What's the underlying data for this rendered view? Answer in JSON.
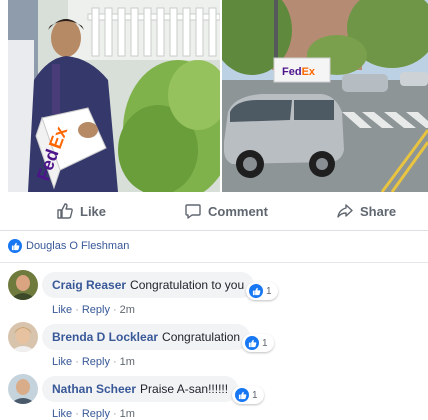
{
  "post": {
    "photos": [
      {
        "name": "delivery-photo",
        "fedex_text": "FedEx"
      },
      {
        "name": "street-photo",
        "fedex_text": "FedEx"
      }
    ],
    "actions": {
      "like_label": "Like",
      "comment_label": "Comment",
      "share_label": "Share"
    },
    "reactions": {
      "icon": "like-icon",
      "name": "Douglas O Fleshman"
    }
  },
  "comments": [
    {
      "author": "Craig Reaser",
      "text": "Congratulation to you",
      "like_label": "Like",
      "reply_label": "Reply",
      "time": "2m",
      "reaction_count": "1"
    },
    {
      "author": "Brenda D Locklear",
      "text": "Congratulation",
      "like_label": "Like",
      "reply_label": "Reply",
      "time": "1m",
      "reaction_count": "1"
    },
    {
      "author": "Nathan Scheer",
      "text": "Praise A-san!!!!!!",
      "like_label": "Like",
      "reply_label": "Reply",
      "time": "1m",
      "reaction_count": "1"
    }
  ],
  "colors": {
    "link": "#385898",
    "accent": "#1877f2",
    "bubble": "#f2f3f5",
    "muted": "#606770"
  }
}
